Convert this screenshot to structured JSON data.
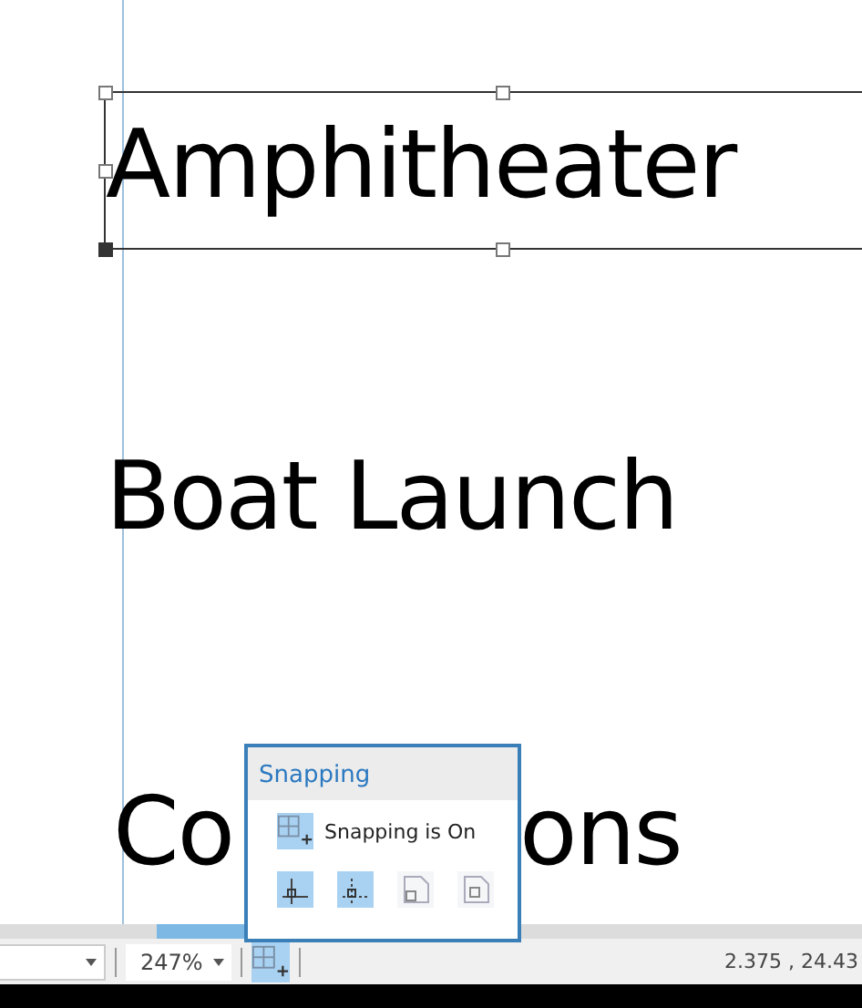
{
  "map_labels": [
    {
      "text": "Amphitheater",
      "selected": true
    },
    {
      "text": "Boat Launch",
      "selected": false
    }
  ],
  "partly_hidden_label": {
    "visible_parts": [
      "Co",
      "ons"
    ]
  },
  "snapping_popup": {
    "title": "Snapping",
    "toggle": {
      "label": "Snapping is On",
      "on": true
    },
    "modes": [
      {
        "on": true
      },
      {
        "on": true
      },
      {
        "on": false
      },
      {
        "on": false
      }
    ]
  },
  "status_bar": {
    "zoom": "247%",
    "snapping_button": {
      "on": true
    },
    "coordinates": "2.375 , 24.43"
  }
}
